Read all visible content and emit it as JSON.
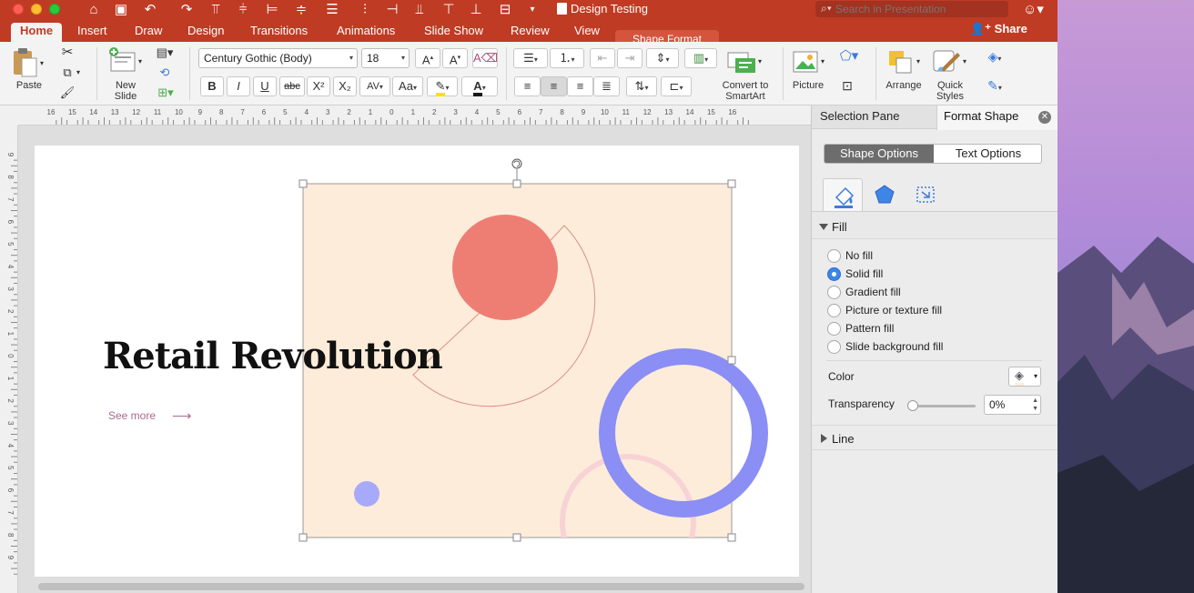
{
  "window": {
    "doc_title": "Design Testing",
    "search_placeholder": "Search in Presentation",
    "share_label": "Share"
  },
  "tabs": [
    {
      "label": "Home"
    },
    {
      "label": "Insert"
    },
    {
      "label": "Draw"
    },
    {
      "label": "Design"
    },
    {
      "label": "Transitions"
    },
    {
      "label": "Animations"
    },
    {
      "label": "Slide Show"
    },
    {
      "label": "Review"
    },
    {
      "label": "View"
    }
  ],
  "contextual_tab": "Shape Format",
  "ribbon": {
    "paste_label": "Paste",
    "new_slide_label": "New\nSlide",
    "font_name": "Century Gothic (Body)",
    "font_size": "18",
    "convert_label": "Convert to\nSmartArt",
    "picture_label": "Picture",
    "arrange_label": "Arrange",
    "quick_styles_label": "Quick\nStyles",
    "bold": "B",
    "italic": "I",
    "underline": "U",
    "strike": "abc",
    "superscript": "X²",
    "subscript": "X₂",
    "spacing": "AV",
    "change_case": "Aa"
  },
  "ruler_h_labels": [
    "16",
    "15",
    "14",
    "13",
    "12",
    "11",
    "10",
    "9",
    "8",
    "7",
    "6",
    "5",
    "4",
    "3",
    "2",
    "1",
    "0",
    "1",
    "2",
    "3",
    "4",
    "5",
    "6",
    "7",
    "8",
    "9",
    "10",
    "11",
    "12",
    "13",
    "14",
    "15",
    "16"
  ],
  "ruler_v_labels": [
    "9",
    "8",
    "7",
    "6",
    "5",
    "4",
    "3",
    "2",
    "1",
    "0",
    "1",
    "2",
    "3",
    "4",
    "5",
    "6",
    "7",
    "8",
    "9"
  ],
  "slide": {
    "title": "Retail Revolution",
    "link_text": "See more",
    "link_arrow": "⟶",
    "colors": {
      "panel": "#fdecd9",
      "coral": "#ee7e74",
      "ring": "#8a8ef5",
      "dot": "#a7a9fa",
      "pink_ring": "#f8d3d6",
      "outline": "#d9928a"
    }
  },
  "pane": {
    "tab_selection": "Selection Pane",
    "tab_format": "Format Shape",
    "seg_shape": "Shape Options",
    "seg_text": "Text Options",
    "fill_header": "Fill",
    "fill_options": [
      {
        "label": "No fill",
        "selected": false
      },
      {
        "label": "Solid fill",
        "selected": true
      },
      {
        "label": "Gradient fill",
        "selected": false
      },
      {
        "label": "Picture or texture fill",
        "selected": false
      },
      {
        "label": "Pattern fill",
        "selected": false
      },
      {
        "label": "Slide background fill",
        "selected": false
      }
    ],
    "color_label": "Color",
    "transparency_label": "Transparency",
    "transparency_value": "0%",
    "line_header": "Line"
  }
}
